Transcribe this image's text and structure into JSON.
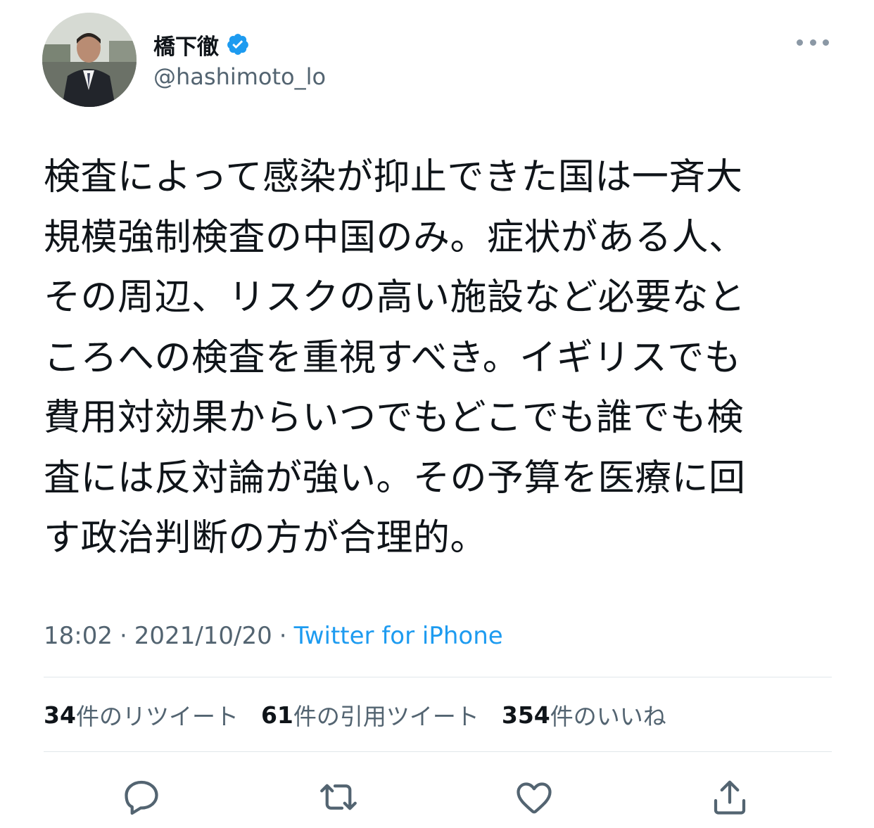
{
  "tweet": {
    "author": {
      "display_name": "橋下徹",
      "handle": "@hashimoto_lo",
      "verified": true
    },
    "text_lines": [
      "検査によって感染が抑止できた国は一斉大",
      "規模強制検査の中国のみ。症状がある人、",
      "その周辺、リスクの高い施設など必要なと",
      "ころへの検査を重視すべき。イギリスでも",
      "費用対効果からいつでもどこでも誰でも検",
      "査には反対論が強い。その予算を医療に回",
      "す政治判断の方が合理的。"
    ],
    "time": "18:02",
    "separator": "·",
    "date": "2021/10/20",
    "source": "Twitter for iPhone"
  },
  "stats": [
    {
      "count": "34",
      "label": "件のリツイート"
    },
    {
      "count": "61",
      "label": "件の引用ツイート"
    },
    {
      "count": "354",
      "label": "件のいいね"
    }
  ],
  "icons": {
    "more": "more-horizontal-icon",
    "reply": "reply-icon",
    "retweet": "retweet-icon",
    "like": "heart-icon",
    "share": "share-icon",
    "verified": "verified-badge-icon"
  },
  "colors": {
    "accent": "#1d9bf0",
    "text_primary": "#0f1419",
    "text_secondary": "#536471",
    "icon": "#536471"
  }
}
